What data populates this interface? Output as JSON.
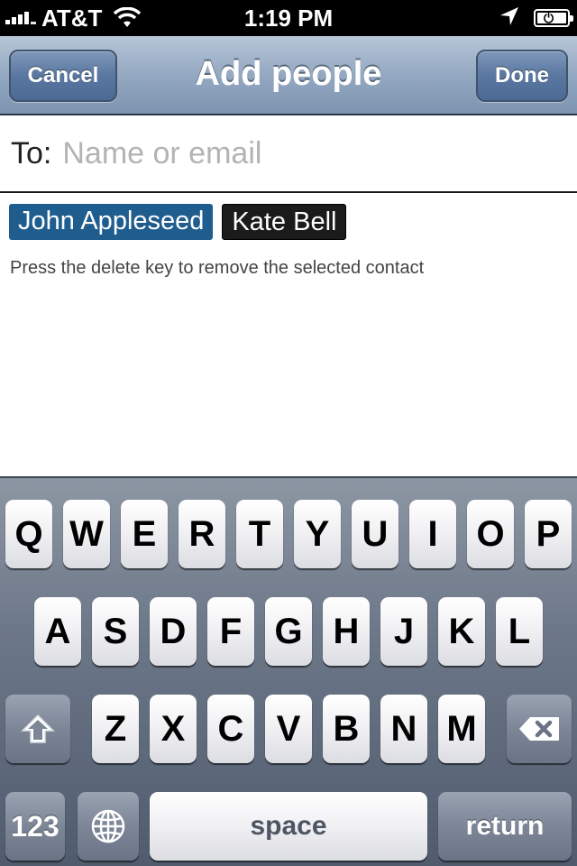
{
  "status_bar": {
    "carrier": "AT&T",
    "time": "1:19 PM",
    "signal_bars": 4
  },
  "nav": {
    "title": "Add people",
    "cancel_label": "Cancel",
    "done_label": "Done"
  },
  "to_field": {
    "label": "To:",
    "placeholder": "Name or email",
    "value": ""
  },
  "recipients": [
    {
      "name": "John Appleseed",
      "selected": true
    },
    {
      "name": "Kate Bell",
      "selected": false
    }
  ],
  "hint_text": "Press the delete key to remove the selected contact",
  "keyboard": {
    "row1": [
      "Q",
      "W",
      "E",
      "R",
      "T",
      "Y",
      "U",
      "I",
      "O",
      "P"
    ],
    "row2": [
      "A",
      "S",
      "D",
      "F",
      "G",
      "H",
      "J",
      "K",
      "L"
    ],
    "row3": [
      "Z",
      "X",
      "C",
      "V",
      "B",
      "N",
      "M"
    ],
    "numbers_label": "123",
    "space_label": "space",
    "return_label": "return"
  },
  "colors": {
    "selected_chip": "#1f5d8f",
    "unselected_chip": "#1b1b1b",
    "nav_button": "#5a77a0"
  }
}
